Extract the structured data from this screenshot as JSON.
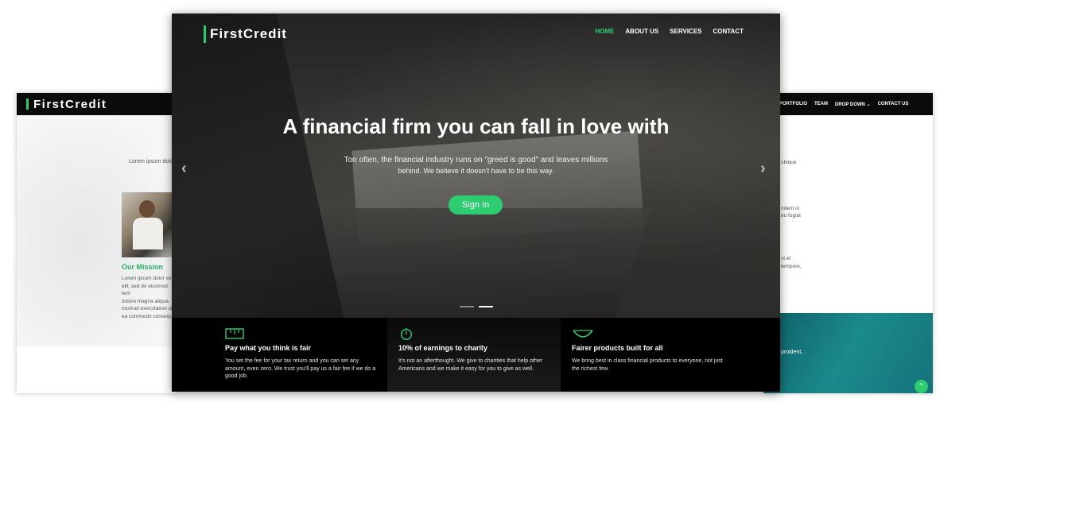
{
  "left_mockup": {
    "logo": "FirstCredit",
    "lorem_top": "Lorem ipsum dolo",
    "mission_title": "Our Mission",
    "mission_text": "Lorem ipsum dolor sit a\nelit, sed do eiusmod tem\ndolore magna aliqua. Ut\nnostrud exercitation ulla\nea commodo consequa"
  },
  "right_mockup": {
    "nav": [
      "PORTFOLIO",
      "TEAM",
      "DROP DOWN ⌄",
      "CONTACT US"
    ],
    "texts": [
      "ubique",
      "ndent in",
      "eu fugiat",
      "st et",
      "tempore,"
    ],
    "teal_text": "proident,",
    "scroll_top_icon": "chevron-up-icon"
  },
  "main": {
    "logo": "FirstCredit",
    "nav": {
      "home": "HOME",
      "about": "ABOUT US",
      "services": "SERVICES",
      "contact": "CONTACT"
    },
    "headline": "A financial firm you can fall in love with",
    "sub1": "Too often, the financial industry runs on \"greed is good\" and leaves millions",
    "sub2": "behind. We believe it doesn't have to be this way.",
    "cta": "Sign In",
    "prev_arrow": "‹",
    "next_arrow": "›",
    "features": [
      {
        "icon": "ruler-icon",
        "title": "Pay what you think is fair",
        "text": "You set the fee for your tax return and you can set any amount, even zero. We trust you'll pay us a fair fee if we do a good job."
      },
      {
        "icon": "stopwatch-icon",
        "title": "10% of earnings to charity",
        "text": "It's not an afterthought. We give to charities that help other Americans and we make it easy for you to give as well."
      },
      {
        "icon": "heart-icon",
        "title": "Fairer products built for all",
        "text": "We bring best in class financial products to everyone, not just the richest few."
      }
    ],
    "accent_color": "#2ecc71"
  }
}
